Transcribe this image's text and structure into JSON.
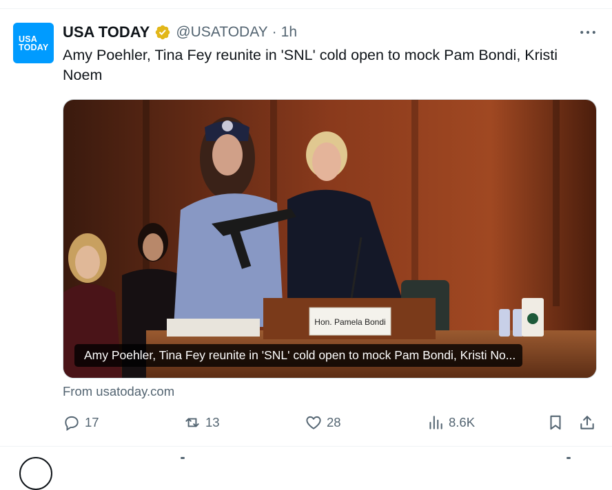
{
  "account": {
    "avatar_line1": "USA",
    "avatar_line2": "TODAY",
    "display_name": "USA TODAY",
    "handle": "@USATODAY",
    "separator": "·",
    "timestamp": "1h",
    "verified_badge_color": "#e2b719",
    "avatar_color": "#009bff"
  },
  "tweet": {
    "text": "Amy Poehler, Tina Fey reunite in 'SNL' cold open to mock Pam Bondi, Kristi Noem"
  },
  "card": {
    "image_caption": "Amy Poehler, Tina Fey reunite in 'SNL' cold open to mock Pam Bondi, Kristi No...",
    "nameplate_text": "Hon. Pamela Bondi",
    "source": "From usatoday.com"
  },
  "actions": {
    "replies": "17",
    "reposts": "13",
    "likes": "28",
    "views": "8.6K"
  },
  "icons": {
    "more": "more-horizontal-icon",
    "reply": "reply-icon",
    "repost": "repost-icon",
    "like": "heart-icon",
    "views": "views-icon",
    "bookmark": "bookmark-icon",
    "share": "share-icon"
  },
  "colors": {
    "secondary_text": "#536471",
    "primary_text": "#0f1419"
  }
}
